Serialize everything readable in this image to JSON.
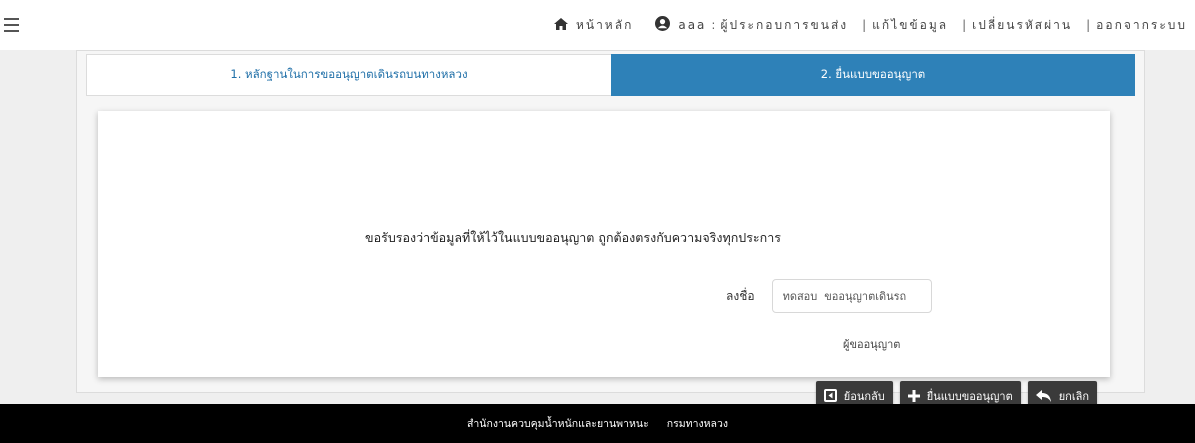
{
  "nav": {
    "home_label": "หน้าหลัก",
    "user_name": "aaa",
    "user_role": "ผู้ประกอบการขนส่ง",
    "edit_profile": "แก้ไขข้อมูล",
    "change_password": "เปลี่ยนรหัสผ่าน",
    "logout": "ออกจากระบบ",
    "separator": "|",
    "colon": ":"
  },
  "tabs": [
    {
      "label": "1. หลักฐานในการขออนุญาตเดินรถบนทางหลวง",
      "active": false
    },
    {
      "label": "2. ยื่นแบบขออนุญาต",
      "active": true
    }
  ],
  "form": {
    "certify_text": "ขอรับรองว่าข้อมูลที่ให้ไว้ในแบบขออนุญาต ถูกต้องตรงกับความจริงทุกประการ",
    "sign_label": "ลงชื่อ",
    "sign_value": "ทดสอบ  ขออนุญาตเดินรถ",
    "sign_caption": "ผู้ขออนุญาต"
  },
  "buttons": {
    "back": "ย้อนกลับ",
    "submit": "ยื่นแบบขออนุญาต",
    "cancel": "ยกเลิก"
  },
  "footer": {
    "org": "สำนักงานควบคุมน้ำหนักและยานพาหนะ",
    "dept": "กรมทางหลวง"
  },
  "colors": {
    "active_tab": "#2e81b8",
    "tab_text": "#1f6fa8",
    "button": "#3a3a3a",
    "footer": "#000000"
  },
  "icons": [
    "menu-icon",
    "home-icon",
    "user-circle-icon",
    "back-square-icon",
    "plus-icon",
    "undo-arrow-icon"
  ]
}
